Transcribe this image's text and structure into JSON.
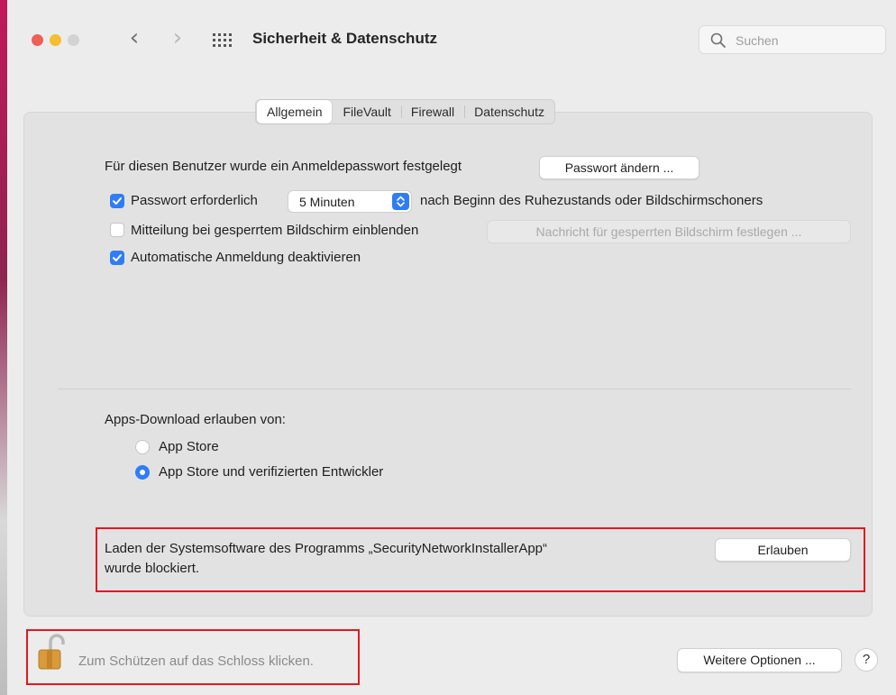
{
  "window": {
    "title": "Sicherheit & Datenschutz",
    "search_placeholder": "Suchen"
  },
  "tabs": [
    {
      "label": "Allgemein",
      "active": true
    },
    {
      "label": "FileVault",
      "active": false
    },
    {
      "label": "Firewall",
      "active": false
    },
    {
      "label": "Datenschutz",
      "active": false
    }
  ],
  "general": {
    "password_set_text": "Für diesen Benutzer wurde ein Anmeldepasswort festgelegt",
    "change_password_button": "Passwort ändern ...",
    "require_password": {
      "label": "Passwort erforderlich",
      "checked": true,
      "selected_value": "5 Minuten",
      "suffix": "nach Beginn des Ruhezustands oder Bildschirmschoners"
    },
    "lock_message": {
      "label": "Mitteilung bei gesperrtem Bildschirm einblenden",
      "checked": false,
      "button": "Nachricht für gesperrten Bildschirm festlegen ..."
    },
    "disable_auto_login": {
      "label": "Automatische Anmeldung deaktivieren",
      "checked": true
    }
  },
  "apps_download": {
    "heading": "Apps-Download erlauben von:",
    "options": [
      {
        "label": "App Store",
        "selected": false
      },
      {
        "label": "App Store und verifizierten Entwickler",
        "selected": true
      }
    ]
  },
  "blocked_software": {
    "line1": "Laden der Systemsoftware des Programms „SecurityNetworkInstallerApp“",
    "line2": "wurde blockiert.",
    "allow_button": "Erlauben"
  },
  "footer": {
    "lock_text": "Zum Schützen auf das Schloss klicken.",
    "more_options_button": "Weitere Optionen ...",
    "help_button": "?"
  },
  "colors": {
    "accent": "#2f7df6",
    "highlight": "#e1191f",
    "window_background": "#ececec",
    "panel_background": "#e2e2e2"
  },
  "icons": [
    "back-chevron-icon",
    "forward-chevron-icon",
    "grid-icon",
    "search-icon",
    "checkmark-icon",
    "stepper-icon",
    "unlocked-lock-icon",
    "help-icon"
  ]
}
